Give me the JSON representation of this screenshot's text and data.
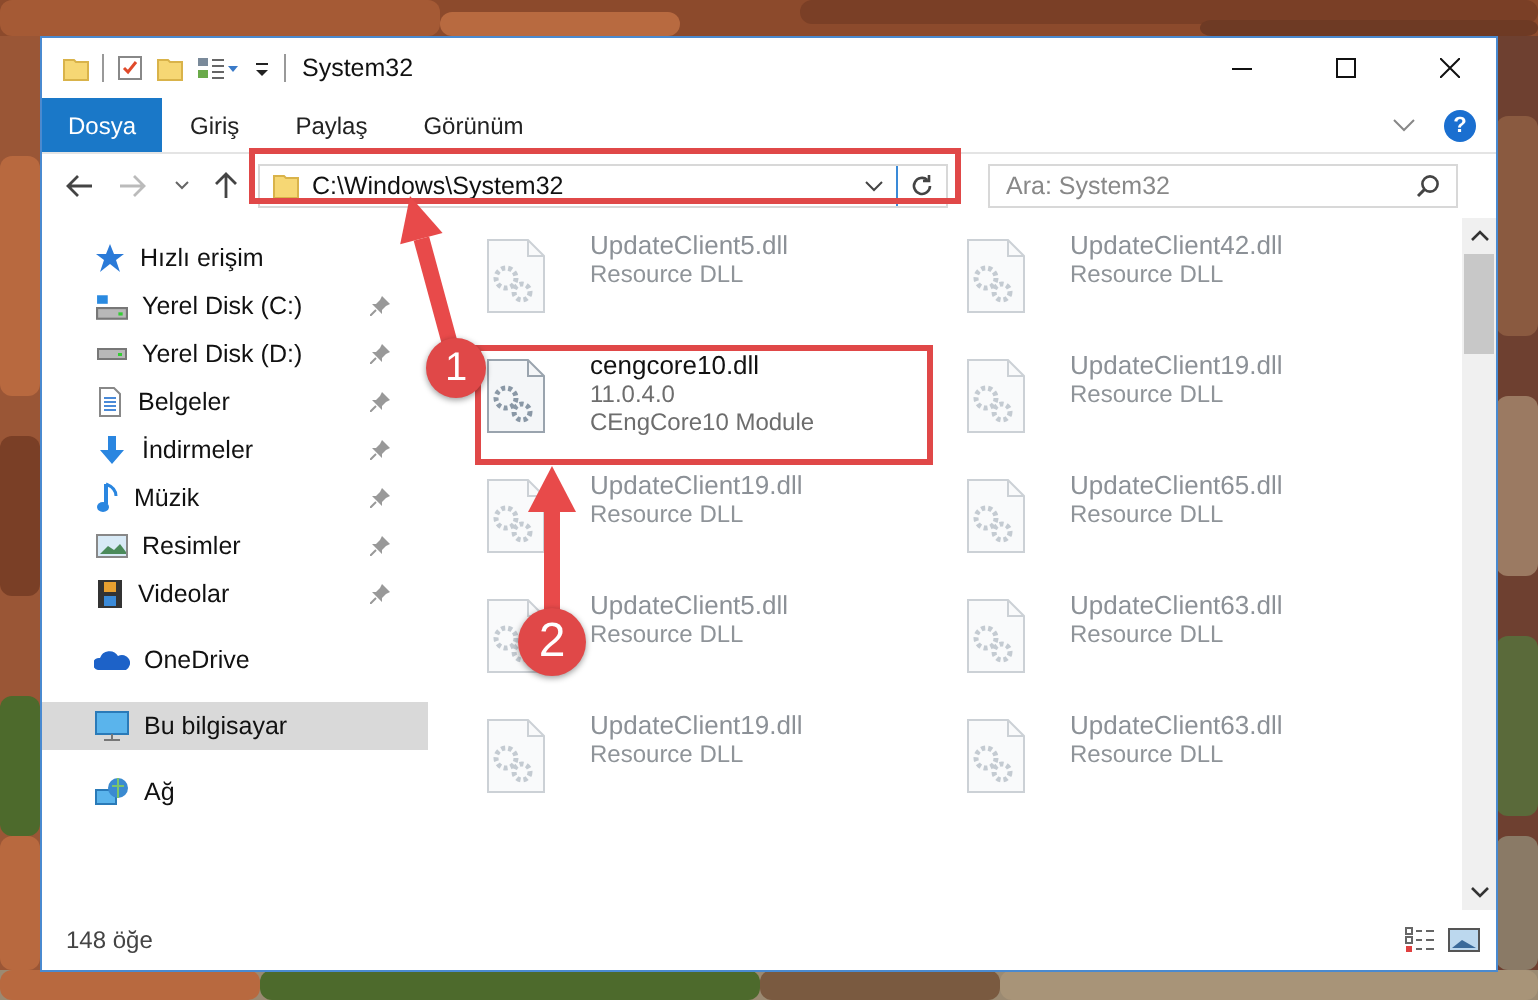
{
  "window": {
    "title": "System32"
  },
  "ribbon": {
    "tabs": [
      {
        "label": "Dosya",
        "selected": true
      },
      {
        "label": "Giriş",
        "selected": false
      },
      {
        "label": "Paylaş",
        "selected": false
      },
      {
        "label": "Görünüm",
        "selected": false
      }
    ],
    "help": "?"
  },
  "address_bar": {
    "path": "C:\\Windows\\System32",
    "forward_disabled": true
  },
  "search": {
    "placeholder": "Ara: System32"
  },
  "sidebar": {
    "items": [
      {
        "label": "Hızlı erişim",
        "selected": false,
        "children": [
          {
            "label": "Yerel Disk (C:)",
            "selected": false,
            "pinned": true
          },
          {
            "label": "Yerel Disk (D:)",
            "selected": false,
            "pinned": true
          },
          {
            "label": "Belgeler",
            "selected": false,
            "pinned": true
          },
          {
            "label": "İndirmeler",
            "selected": false,
            "pinned": true
          },
          {
            "label": "Müzik",
            "selected": false,
            "pinned": true
          },
          {
            "label": "Resimler",
            "selected": false,
            "pinned": true
          },
          {
            "label": "Videolar",
            "selected": false,
            "pinned": true
          }
        ]
      },
      {
        "label": "OneDrive",
        "selected": false
      },
      {
        "label": "Bu bilgisayar",
        "selected": true
      },
      {
        "label": "Ağ",
        "selected": false
      }
    ]
  },
  "files": [
    {
      "name": "UpdateClient5.dll",
      "details": [
        "Resource DLL"
      ],
      "blurred": true
    },
    {
      "name": "UpdateClient42.dll",
      "details": [
        "Resource DLL"
      ],
      "blurred": true
    },
    {
      "name": "cengcore10.dll",
      "details": [
        "11.0.4.0",
        "CEngCore10 Module"
      ],
      "blurred": false
    },
    {
      "name": "UpdateClient19.dll",
      "details": [
        "Resource DLL"
      ],
      "blurred": true
    },
    {
      "name": "UpdateClient19.dll",
      "details": [
        "Resource DLL"
      ],
      "blurred": true
    },
    {
      "name": "UpdateClient65.dll",
      "details": [
        "Resource DLL"
      ],
      "blurred": true
    },
    {
      "name": "UpdateClient5.dll",
      "details": [
        "Resource DLL"
      ],
      "blurred": true
    },
    {
      "name": "UpdateClient63.dll",
      "details": [
        "Resource DLL"
      ],
      "blurred": true
    },
    {
      "name": "UpdateClient19.dll",
      "details": [
        "Resource DLL"
      ],
      "blurred": true
    },
    {
      "name": "UpdateClient63.dll",
      "details": [
        "Resource DLL"
      ],
      "blurred": true
    }
  ],
  "callouts": [
    {
      "number": "1"
    },
    {
      "number": "2"
    }
  ],
  "status_bar": {
    "count": "148 öğe"
  }
}
